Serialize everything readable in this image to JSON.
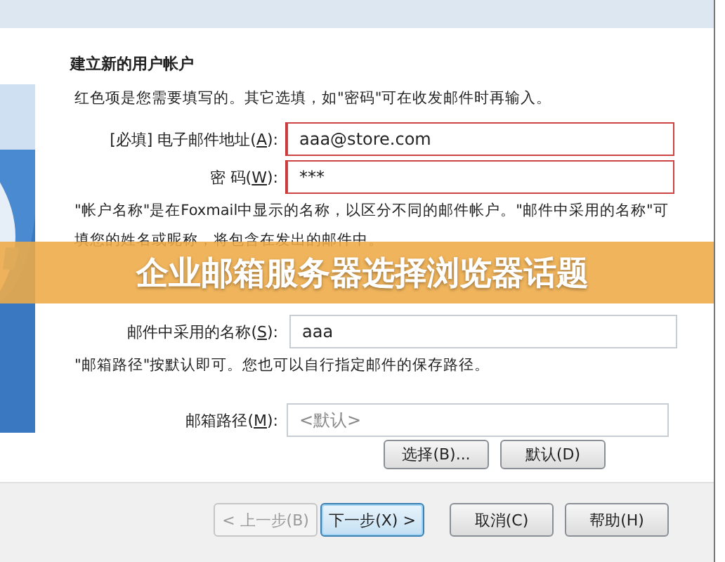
{
  "dialog": {
    "heading": "建立新的用户帐户",
    "intro": "红色项是您需要填写的。其它选填，如\"密码\"可在收发邮件时再输入。",
    "account_fields": [
      {
        "label_before": "[必填] 电子邮件地址(",
        "access_key": "A",
        "label_after": "):",
        "value": "aaa@store.com",
        "required": true
      },
      {
        "label_before": "密 码(",
        "access_key": "W",
        "label_after": "):",
        "value": "***",
        "required": true
      }
    ],
    "name_note": "\"帐户名称\"是在Foxmail中显示的名称，以区分不同的邮件帐户。\"邮件中采用的名称\"可填您的姓名或昵称，将包含在发出的邮件中。",
    "name_field": {
      "label_before": "邮件中采用的名称(",
      "access_key": "S",
      "label_after": "):",
      "value": "aaa"
    },
    "path_note": "\"邮箱路径\"按默认即可。您也可以自行指定邮件的保存路径。",
    "path_field": {
      "label_before": "邮箱路径(",
      "access_key": "M",
      "label_after": "):",
      "placeholder": "<默认>"
    },
    "path_buttons": [
      {
        "label": "选择(B)...",
        "disabled": false,
        "default": false
      },
      {
        "label": "默认(D)",
        "disabled": false,
        "default": false
      }
    ],
    "footer_buttons": [
      {
        "label": "< 上一步(B)",
        "disabled": true,
        "default": false
      },
      {
        "label": "下一步(X) >",
        "disabled": false,
        "default": true
      },
      {
        "label": "取消(C)",
        "disabled": false,
        "default": false
      },
      {
        "label": "帮助(H)",
        "disabled": false,
        "default": false
      }
    ]
  },
  "banner": {
    "title": "企业邮箱服务器选择浏览器话题"
  }
}
